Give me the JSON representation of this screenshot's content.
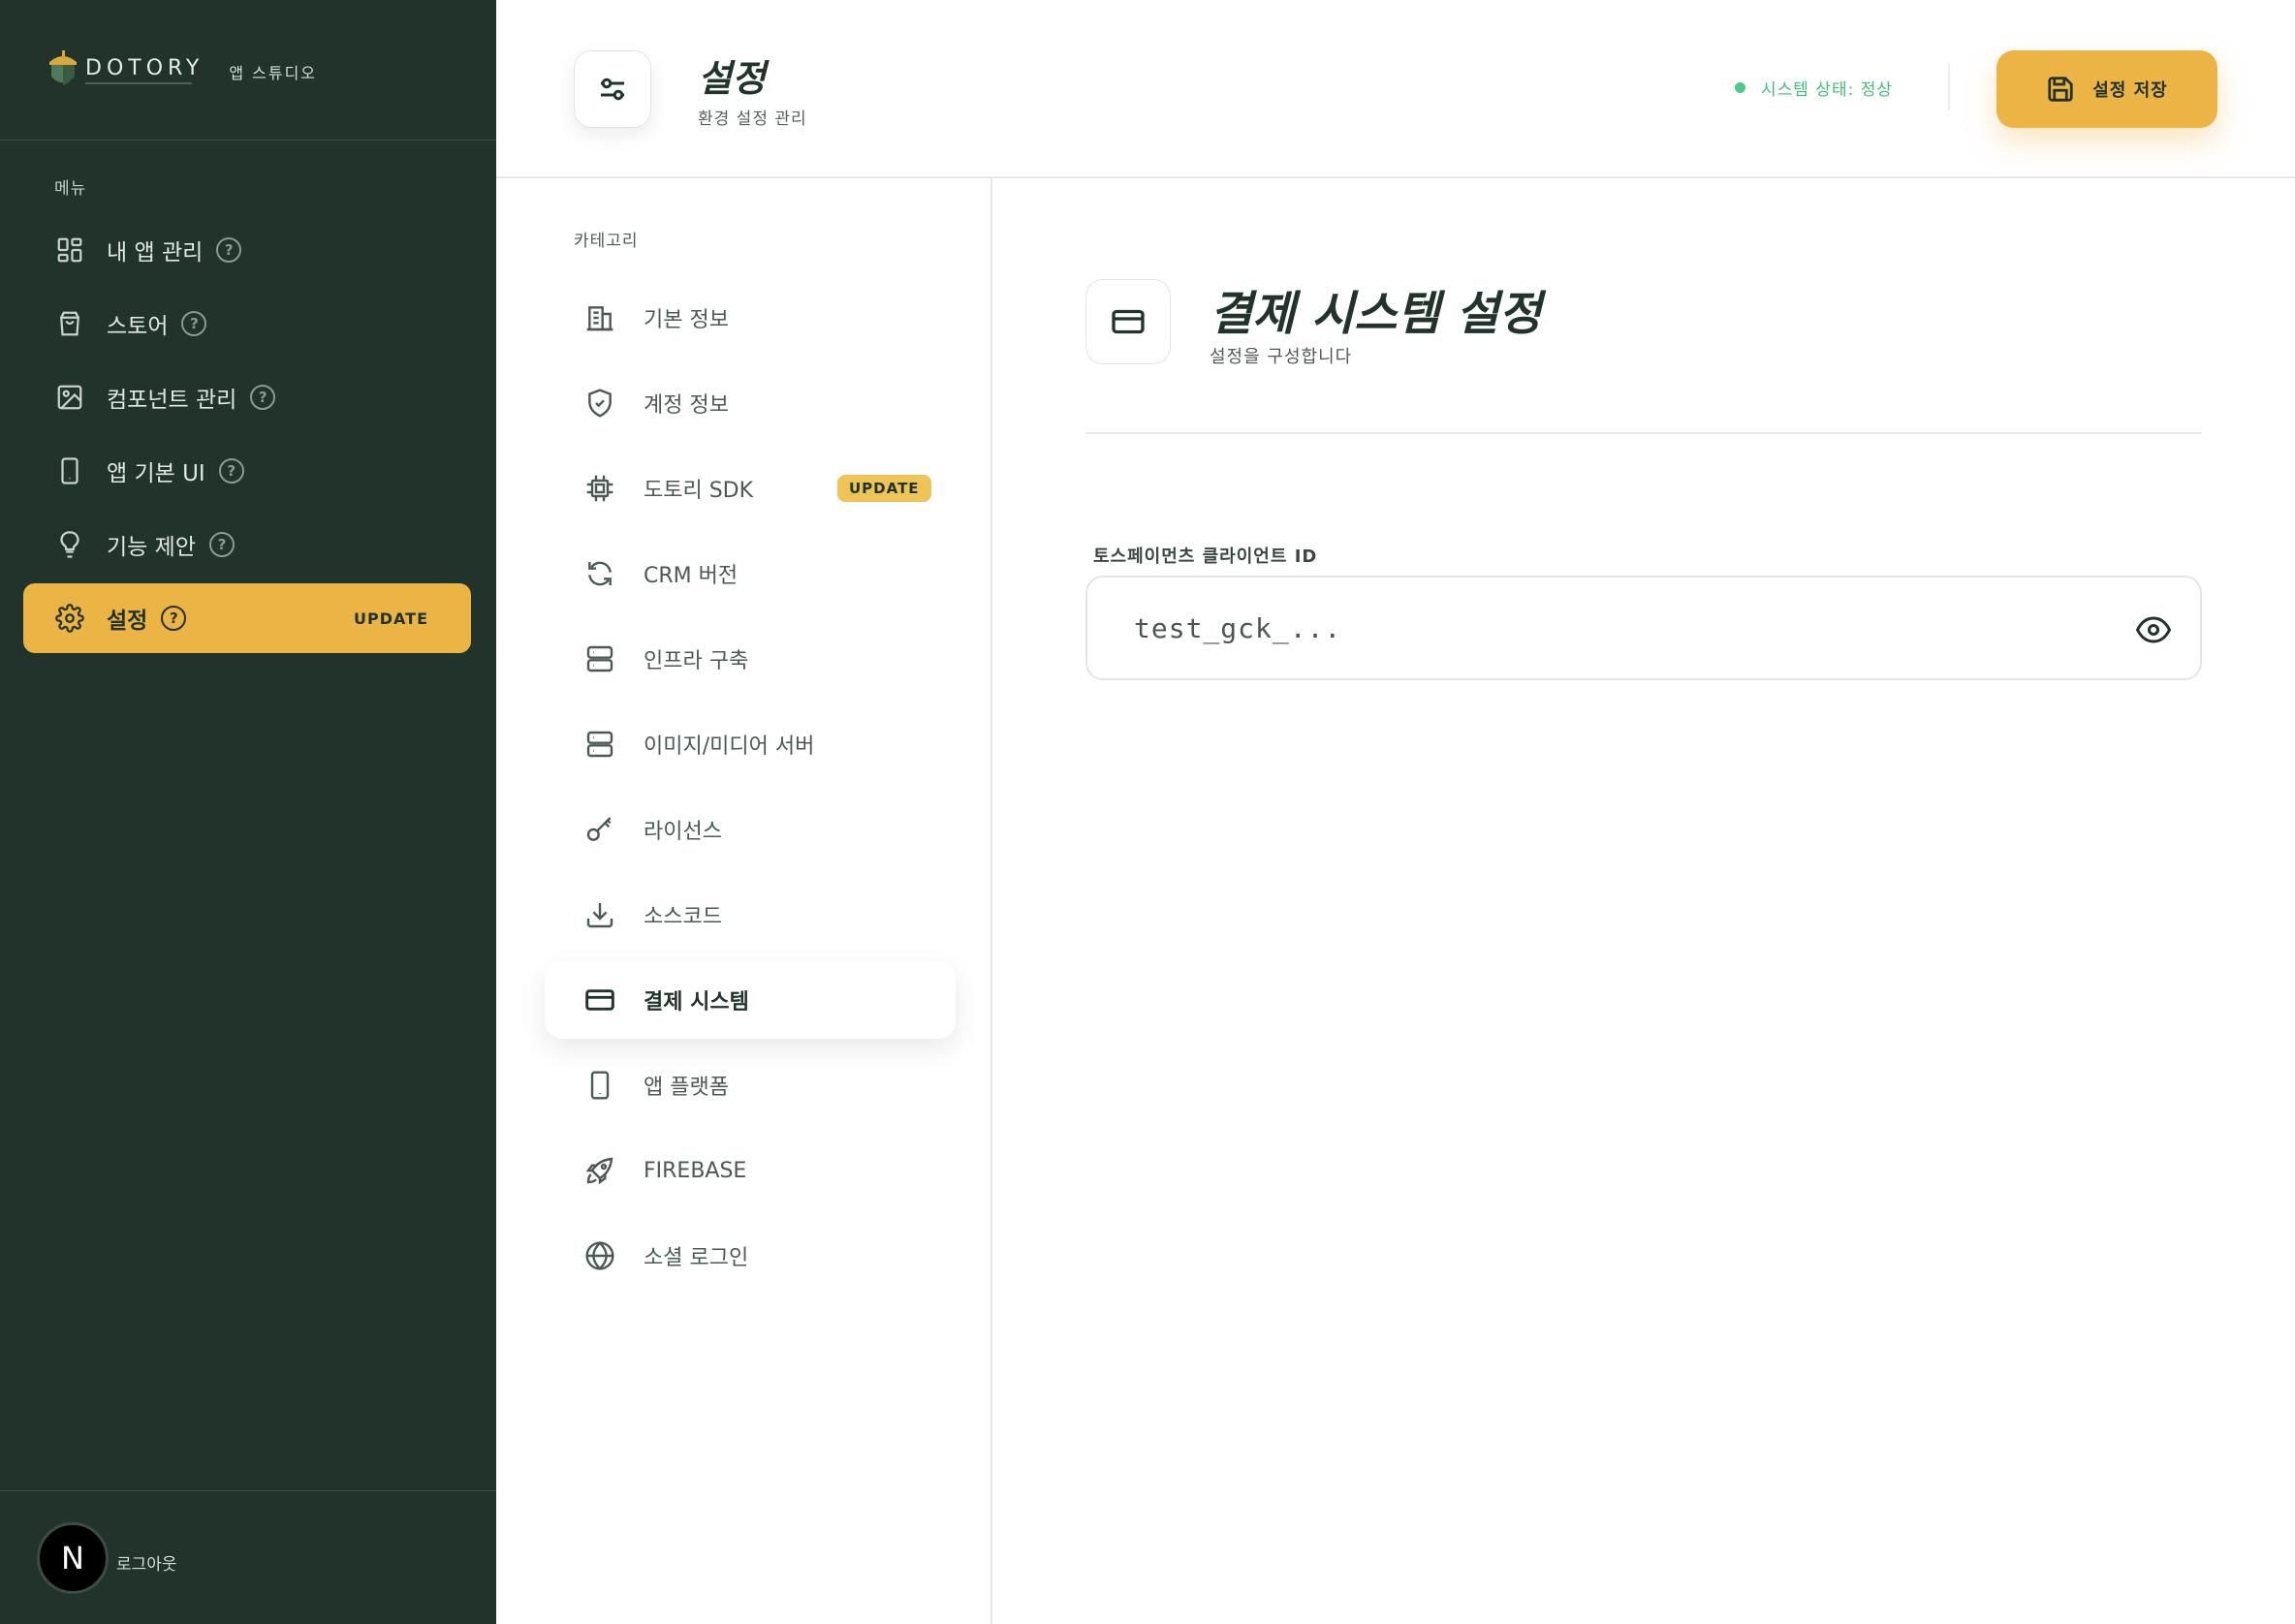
{
  "brand": {
    "name": "DOTORY",
    "subtitle": "앱 스튜디오"
  },
  "sidebar": {
    "menu_label": "메뉴",
    "items": [
      {
        "label": "내 앱 관리",
        "icon": "dashboard-icon",
        "help": "?"
      },
      {
        "label": "스토어",
        "icon": "shopping-bag-icon",
        "help": "?"
      },
      {
        "label": "컴포넌트 관리",
        "icon": "image-icon",
        "help": "?"
      },
      {
        "label": "앱 기본 UI",
        "icon": "smartphone-icon",
        "help": "?"
      },
      {
        "label": "기능 제안",
        "icon": "lightbulb-icon",
        "help": "?"
      },
      {
        "label": "설정",
        "icon": "gear-icon",
        "help": "?",
        "badge": "UPDATE",
        "active": true
      }
    ],
    "avatar_letter": "N",
    "logout": "로그아웃"
  },
  "header": {
    "title": "설정",
    "subtitle": "환경 설정 관리",
    "status": "시스템 상태: 정상",
    "save_label": "설정 저장"
  },
  "categories": {
    "label": "카테고리",
    "items": [
      {
        "label": "기본 정보",
        "icon": "building-icon"
      },
      {
        "label": "계정 정보",
        "icon": "shield-check-icon"
      },
      {
        "label": "도토리 SDK",
        "icon": "chip-icon",
        "badge": "UPDATE"
      },
      {
        "label": "CRM 버전",
        "icon": "refresh-icon"
      },
      {
        "label": "인프라 구축",
        "icon": "server-icon"
      },
      {
        "label": "이미지/미디어 서버",
        "icon": "server-icon"
      },
      {
        "label": "라이선스",
        "icon": "key-icon"
      },
      {
        "label": "소스코드",
        "icon": "download-icon"
      },
      {
        "label": "결제 시스템",
        "icon": "credit-card-icon",
        "active": true
      },
      {
        "label": "앱 플랫폼",
        "icon": "smartphone-icon"
      },
      {
        "label": "FIREBASE",
        "icon": "rocket-icon"
      },
      {
        "label": "소셜 로그인",
        "icon": "globe-icon"
      }
    ]
  },
  "main": {
    "title": "결제 시스템 설정",
    "subtitle": "설정을 구성합니다",
    "field_label": "토스페이먼츠 클라이언트 ID",
    "field_placeholder": "test_gck_..."
  },
  "colors": {
    "sidebar_bg": "#21332a",
    "accent": "#ebb444",
    "status_green": "#3fbf78"
  }
}
